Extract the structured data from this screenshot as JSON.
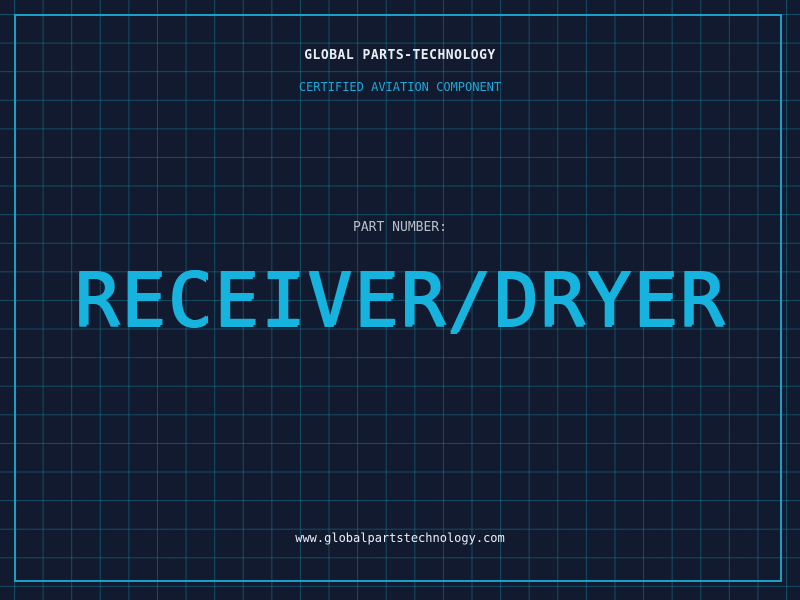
{
  "header": {
    "company_name": "GLOBAL PARTS-TECHNOLOGY",
    "tagline": "CERTIFIED AVIATION COMPONENT"
  },
  "part": {
    "label": "PART NUMBER:",
    "name": "RECEIVER/DRYER"
  },
  "footer": {
    "website": "www.globalpartstechnology.com"
  },
  "colors": {
    "background": "#111a2e",
    "grid": "#168caa",
    "accent": "#16b3de",
    "text": "#e9eef5",
    "muted": "#b7c0cc"
  }
}
